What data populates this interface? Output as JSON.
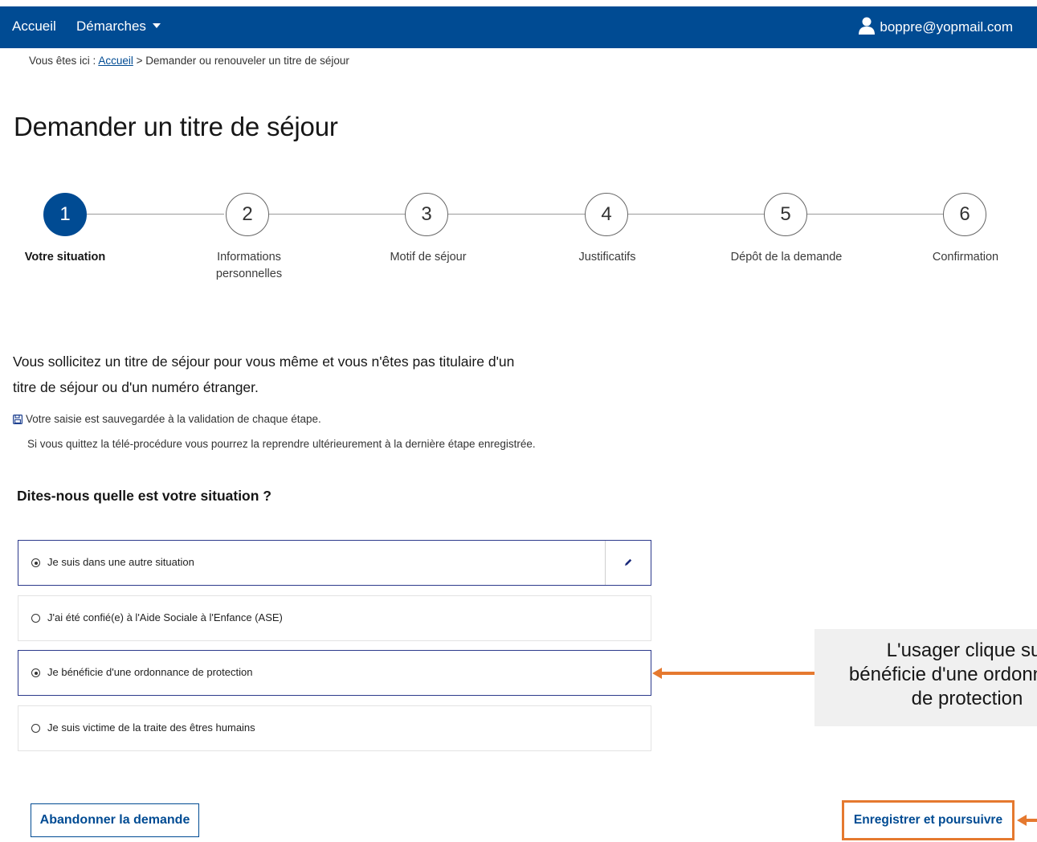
{
  "topbar": {
    "nav": [
      "Accueil",
      "Démarches"
    ],
    "user_email": "boppre@yopmail.com"
  },
  "breadcrumb": {
    "prefix": "Vous êtes ici :",
    "home": "Accueil",
    "separator": ">",
    "current": "Demander ou renouveler un titre de séjour"
  },
  "page": {
    "title": "Demander un titre de séjour"
  },
  "stepper": {
    "current_step": 1,
    "steps": [
      {
        "number": "1",
        "label": "Votre situation"
      },
      {
        "number": "2",
        "label": "Informations personnelles"
      },
      {
        "number": "3",
        "label": "Motif de séjour"
      },
      {
        "number": "4",
        "label": "Justificatifs"
      },
      {
        "number": "5",
        "label": "Dépôt de la demande"
      },
      {
        "number": "6",
        "label": "Confirmation"
      }
    ]
  },
  "intro": {
    "text": "Vous sollicitez un titre de séjour pour vous même et vous n'êtes pas titulaire d'un titre de séjour ou d'un numéro étranger.",
    "save_note": "Votre saisie est sauvegardée à la validation de chaque étape.",
    "resume_note": "Si vous quittez la télé-procédure vous pourrez la reprendre ultérieurement à la dernière étape enregistrée."
  },
  "question": {
    "label": "Dites-nous quelle est votre situation ?",
    "options": [
      {
        "label": "Je suis dans une autre situation",
        "state": "checked-with-edit"
      },
      {
        "label": "J'ai été confié(e) à l'Aide Sociale à l'Enfance (ASE)",
        "state": "unchecked"
      },
      {
        "label": "Je bénéficie d'une ordonnance de protection",
        "state": "selected"
      },
      {
        "label": "Je suis victime de la traite des êtres humains",
        "state": "unchecked"
      }
    ]
  },
  "annotation": {
    "lines": [
      "L'usager clique sur",
      "bénéficie d'une ordonnance",
      "de protection"
    ],
    "accent_color": "#e5792f"
  },
  "actions": {
    "abandon_label": "Abandonner la demande",
    "continue_label": "Enregistrer et poursuivre"
  },
  "colors": {
    "brand_blue": "#004b93",
    "selected_border": "#2c3a8c",
    "annotation_orange": "#e5792f"
  },
  "icons": {
    "user": "user-icon",
    "dropdown": "caret-down-icon",
    "save": "floppy-disk-icon",
    "edit": "pencil-icon",
    "arrow": "arrow-left-icon"
  }
}
